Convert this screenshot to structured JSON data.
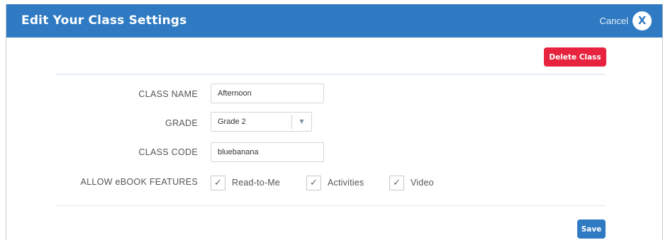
{
  "dialog": {
    "title": "Edit Your Class Settings",
    "cancel_label": "Cancel",
    "close_icon": "X"
  },
  "actions": {
    "delete_label": "Delete Class",
    "save_label": "Save"
  },
  "form": {
    "class_name": {
      "label": "CLASS NAME",
      "value": "Afternoon"
    },
    "grade": {
      "label": "GRADE",
      "value": "Grade 2",
      "chevron": "▼"
    },
    "class_code": {
      "label": "CLASS CODE",
      "value": "bluebanana"
    },
    "ebook_features": {
      "label": "ALLOW eBOOK FEATURES",
      "options": [
        {
          "label": "Read-to-Me",
          "checked": true,
          "mark": "✓"
        },
        {
          "label": "Activities",
          "checked": true,
          "mark": "✓"
        },
        {
          "label": "Video",
          "checked": true,
          "mark": "✓"
        }
      ]
    }
  },
  "colors": {
    "header": "#2f7ac2",
    "delete": "#e8233f",
    "save": "#2f7ac2"
  }
}
